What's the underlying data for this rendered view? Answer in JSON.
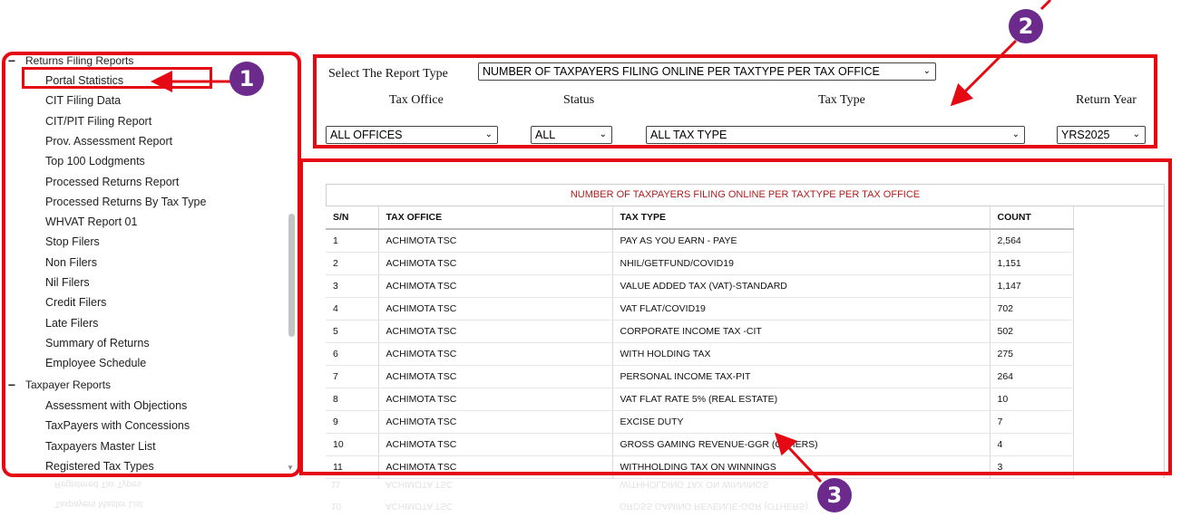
{
  "sidebar": {
    "group1": "Returns Filing Reports",
    "items1": [
      "Portal Statistics",
      "CIT Filing Data",
      "CIT/PIT Filing Report",
      "Prov. Assessment Report",
      "Top 100 Lodgments",
      "Processed Returns Report",
      "Processed Returns By Tax Type",
      "WHVAT Report 01",
      "Stop Filers",
      "Non Filers",
      "Nil Filers",
      "Credit Filers",
      "Late Filers",
      "Summary of Returns",
      "Employee Schedule"
    ],
    "group2": "Taxpayer Reports",
    "items2": [
      "Assessment with Objections",
      "TaxPayers with Concessions",
      "Taxpayers Master List",
      "Registered Tax Types"
    ]
  },
  "filters": {
    "report_type_label": "Select The Report Type",
    "report_type_value": "NUMBER OF TAXPAYERS FILING ONLINE PER TAXTYPE PER TAX OFFICE",
    "tax_office_label": "Tax Office",
    "tax_office_value": "ALL OFFICES",
    "status_label": "Status",
    "status_value": "ALL",
    "tax_type_label": "Tax Type",
    "tax_type_value": "ALL TAX TYPE",
    "return_year_label": "Return Year",
    "return_year_value": "YRS2025"
  },
  "report": {
    "title": "NUMBER OF TAXPAYERS FILING ONLINE PER TAXTYPE PER TAX OFFICE",
    "headers": [
      "S/N",
      "TAX OFFICE",
      "TAX TYPE",
      "COUNT"
    ],
    "rows": [
      [
        "1",
        "ACHIMOTA TSC",
        "PAY AS YOU EARN - PAYE",
        "2,564"
      ],
      [
        "2",
        "ACHIMOTA TSC",
        "NHIL/GETFUND/COVID19",
        "1,151"
      ],
      [
        "3",
        "ACHIMOTA TSC",
        "VALUE ADDED TAX (VAT)-STANDARD",
        "1,147"
      ],
      [
        "4",
        "ACHIMOTA TSC",
        "VAT FLAT/COVID19",
        "702"
      ],
      [
        "5",
        "ACHIMOTA TSC",
        "CORPORATE INCOME TAX -CIT",
        "502"
      ],
      [
        "6",
        "ACHIMOTA TSC",
        "WITH HOLDING TAX",
        "275"
      ],
      [
        "7",
        "ACHIMOTA TSC",
        "PERSONAL INCOME TAX-PIT",
        "264"
      ],
      [
        "8",
        "ACHIMOTA TSC",
        "VAT FLAT RATE 5% (REAL ESTATE)",
        "10"
      ],
      [
        "9",
        "ACHIMOTA TSC",
        "EXCISE DUTY",
        "7"
      ],
      [
        "10",
        "ACHIMOTA TSC",
        "GROSS GAMING REVENUE-GGR (OTHERS)",
        "4"
      ],
      [
        "11",
        "ACHIMOTA TSC",
        "WITHHOLDING TAX ON WINNINGS",
        "3"
      ]
    ]
  },
  "annotations": {
    "markers": [
      "1",
      "2",
      "3"
    ],
    "color": "#e50914",
    "marker_color": "#6b2a8c"
  },
  "colors": {
    "report_title": "#b01d1d"
  }
}
